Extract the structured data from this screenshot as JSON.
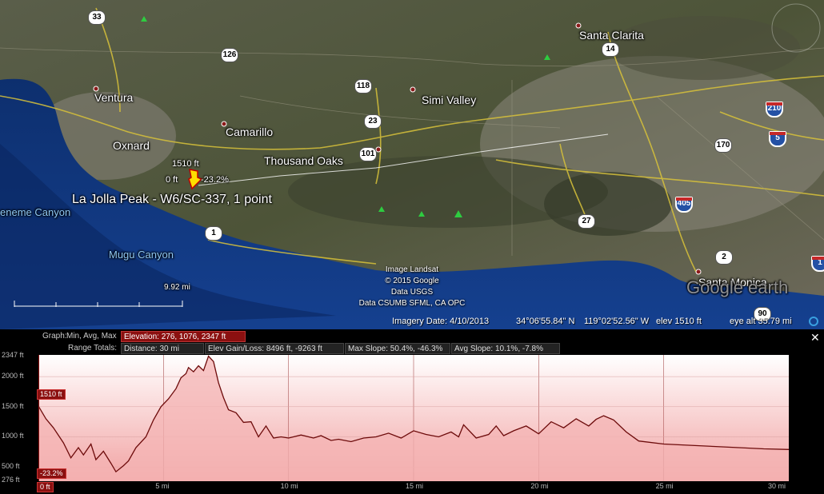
{
  "map": {
    "cities": [
      {
        "name": "Santa Clarita"
      },
      {
        "name": "Simi Valley"
      },
      {
        "name": "Ventura"
      },
      {
        "name": "Camarillo"
      },
      {
        "name": "Oxnard"
      },
      {
        "name": "Thousand Oaks"
      },
      {
        "name": "Santa Monica"
      }
    ],
    "ocean_labels": [
      "Mugu Canyon",
      "eneme Canyon"
    ],
    "shields": [
      "33",
      "126",
      "14",
      "118",
      "23",
      "101",
      "170",
      "27",
      "1",
      "2",
      "90"
    ],
    "interstates": [
      "210",
      "5",
      "405",
      "1"
    ],
    "placemark": {
      "name": "La Jolla Peak - W6/SC-337, 1 point",
      "elev_top": "1510 ft",
      "elev_low": "0 ft",
      "slope": "-23.2%"
    },
    "scale_label": "9.92 mi",
    "credits": [
      "Image Landsat",
      "© 2015 Google",
      "Data USGS",
      "Data CSUMB SFML, CA OPC"
    ],
    "watermark": "Google earth"
  },
  "status": {
    "imagery_date": "Imagery Date: 4/10/2013",
    "lat": "34°06'55.84\" N",
    "lon": "119°02'52.56\" W",
    "elev": "elev  1510 ft",
    "eye_alt": "eye alt  35.79 mi"
  },
  "profile": {
    "graph_label": "Graph:",
    "graph_modes": "Min, Avg, Max",
    "elevation_stats": "Elevation: 276, 1076, 2347 ft",
    "range_totals_label": "Range Totals:",
    "distance": "Distance: 30 mi",
    "elev_gain_loss": "Elev Gain/Loss: 8496 ft, -9263 ft",
    "max_slope": "Max Slope: 50.4%, -46.3%",
    "avg_slope": "Avg Slope: 10.1%, -7.8%",
    "close_symbol": "✕",
    "cursor_elev": "1510 ft",
    "cursor_slope": "-23.2%",
    "cursor_dist": "0 ft",
    "y_tick_labels": [
      "2347 ft",
      "2000 ft",
      "1500 ft",
      "1000 ft",
      "500 ft",
      "276 ft"
    ],
    "x_tick_labels": [
      "5 mi",
      "10 mi",
      "15 mi",
      "20 mi",
      "25 mi",
      "30 mi"
    ]
  },
  "chart_data": {
    "type": "area",
    "xlabel": "",
    "ylabel": "",
    "xlim": [
      0,
      30
    ],
    "ylim": [
      276,
      2347
    ],
    "x": [
      0,
      0.3,
      0.6,
      1.0,
      1.3,
      1.6,
      1.8,
      2.1,
      2.3,
      2.6,
      2.9,
      3.1,
      3.4,
      3.6,
      3.9,
      4.3,
      4.6,
      4.9,
      5.2,
      5.5,
      5.7,
      5.9,
      6.0,
      6.2,
      6.4,
      6.6,
      6.8,
      7.0,
      7.2,
      7.4,
      7.6,
      7.9,
      8.2,
      8.5,
      8.8,
      9.1,
      9.4,
      9.7,
      10.0,
      10.5,
      11.0,
      11.3,
      11.7,
      12.0,
      12.5,
      13.0,
      13.5,
      14.0,
      14.5,
      15.0,
      15.5,
      16.0,
      16.5,
      16.8,
      17.0,
      17.5,
      18.0,
      18.3,
      18.6,
      19.0,
      19.5,
      20.0,
      20.5,
      21.0,
      21.5,
      22.0,
      22.3,
      22.6,
      23.0,
      23.5,
      24.0,
      25.0,
      26.0,
      27.0,
      28.0,
      29.0,
      30.0
    ],
    "values": [
      1510,
      1300,
      1150,
      900,
      650,
      820,
      700,
      880,
      620,
      760,
      560,
      420,
      520,
      600,
      820,
      1000,
      1280,
      1500,
      1630,
      1800,
      1980,
      2050,
      2150,
      2080,
      2180,
      2100,
      2340,
      2250,
      1900,
      1650,
      1450,
      1400,
      1240,
      1250,
      1000,
      1180,
      980,
      1000,
      980,
      1030,
      980,
      1020,
      940,
      960,
      920,
      980,
      1000,
      1060,
      980,
      1100,
      1040,
      1000,
      1080,
      1000,
      1200,
      980,
      1040,
      1180,
      1020,
      1100,
      1180,
      1050,
      1250,
      1150,
      1300,
      1180,
      1290,
      1350,
      1280,
      1080,
      930,
      880,
      860,
      840,
      820,
      800,
      790
    ]
  },
  "colors": {
    "panel_bg": "#000000",
    "plot_top": "#ffffff",
    "plot_fill": "#f2a3a3",
    "profile_line": "#6d0b0b",
    "accent": "#8b1010"
  }
}
